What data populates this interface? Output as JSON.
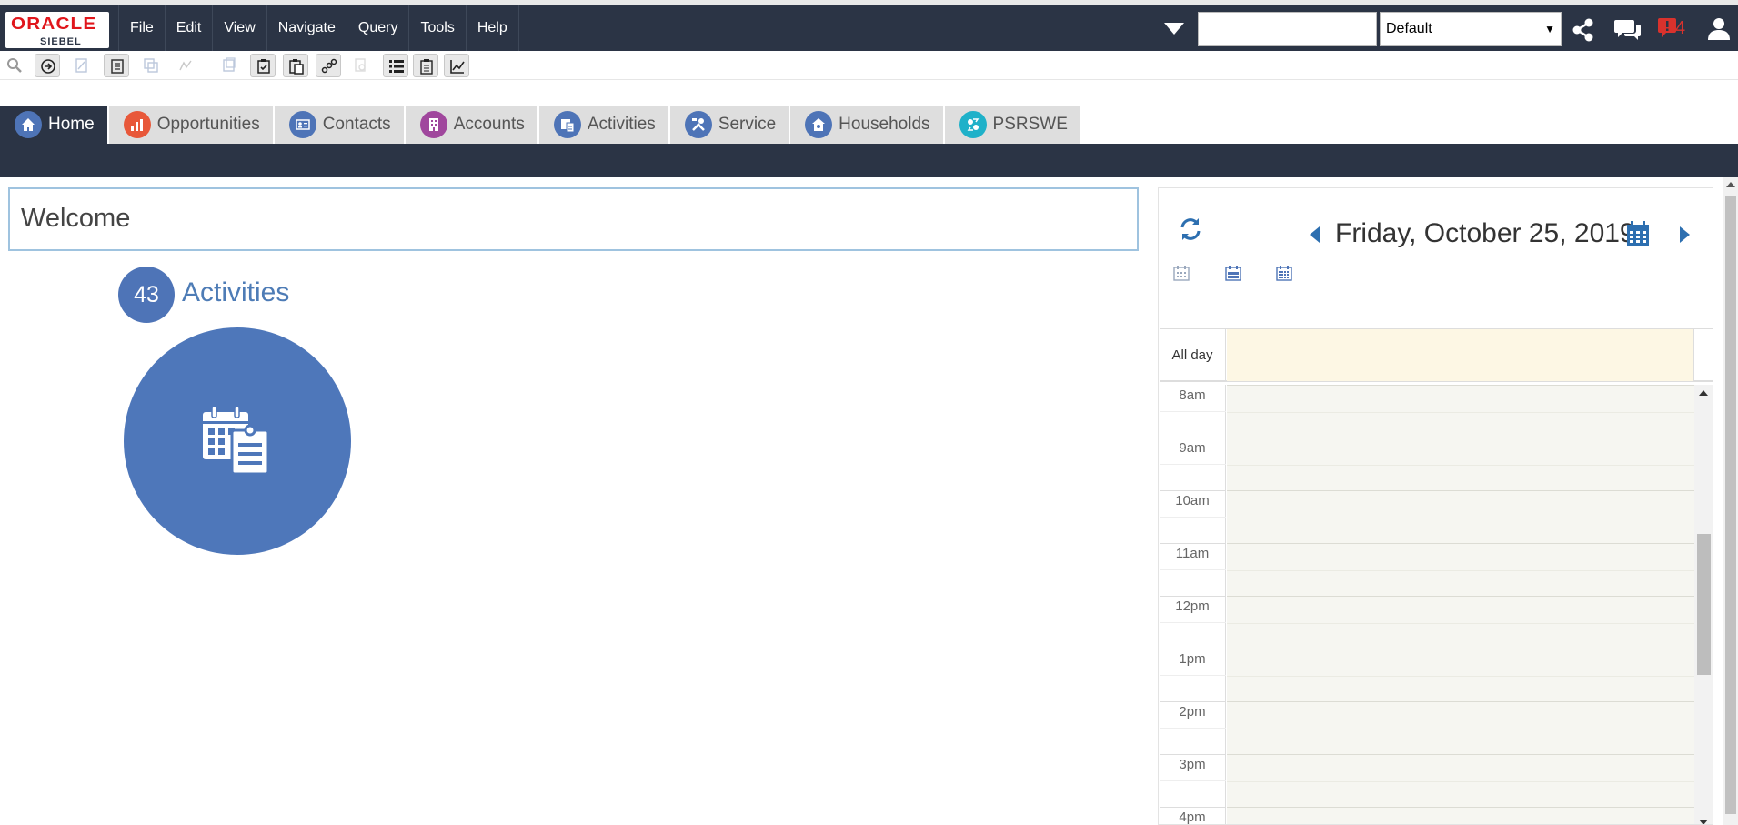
{
  "brand": {
    "oracle": "ORACLE",
    "product": "SIEBEL"
  },
  "menu": [
    "File",
    "Edit",
    "View",
    "Navigate",
    "Query",
    "Tools",
    "Help"
  ],
  "search": {
    "value": "",
    "placeholder": ""
  },
  "scope_select": {
    "selected": "Default"
  },
  "notifications": {
    "count": "4"
  },
  "tabs": [
    {
      "label": "Home",
      "color": "#4e74b7"
    },
    {
      "label": "Opportunities",
      "color": "#e8583a"
    },
    {
      "label": "Contacts",
      "color": "#4e74b7"
    },
    {
      "label": "Accounts",
      "color": "#a0479d"
    },
    {
      "label": "Activities",
      "color": "#4e74b7"
    },
    {
      "label": "Service",
      "color": "#4e74b7"
    },
    {
      "label": "Households",
      "color": "#4e74b7"
    },
    {
      "label": "PSRSWE",
      "color": "#1fb1c9"
    }
  ],
  "welcome": {
    "title": "Welcome"
  },
  "activities": {
    "count": "43",
    "label": "Activities"
  },
  "calendar": {
    "date": "Friday, October 25, 2019",
    "all_day_label": "All day",
    "hours": [
      "8am",
      "9am",
      "10am",
      "11am",
      "12pm",
      "1pm",
      "2pm",
      "3pm",
      "4pm"
    ]
  },
  "colors": {
    "header_bg": "#2b3445",
    "accent_blue": "#4e74b7",
    "oracle_red": "#e0151b",
    "all_day_bg": "#fdf7e4"
  }
}
